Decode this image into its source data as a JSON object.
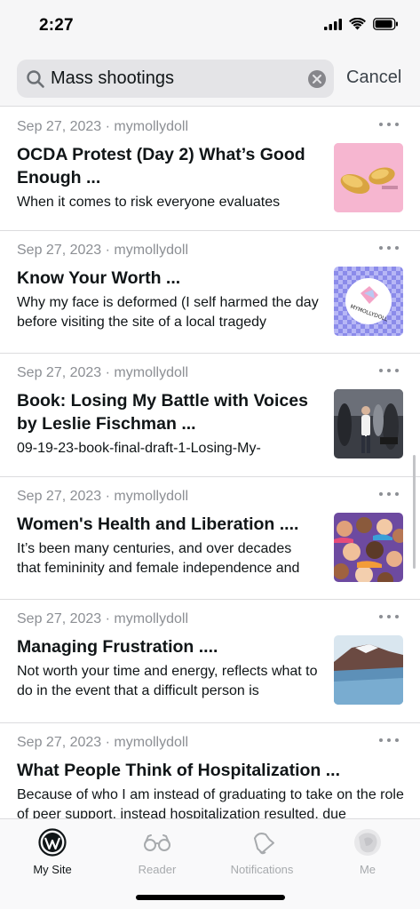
{
  "status_bar": {
    "time": "2:27"
  },
  "search": {
    "query": "Mass shootings",
    "cancel_label": "Cancel"
  },
  "posts": [
    {
      "date": "Sep 27, 2023",
      "author": "mymollydoll",
      "title": "OCDA Protest (Day 2) What’s Good Enough ...",
      "excerpt": "When it comes to risk everyone evaluates",
      "thumb": "boxing-gloves"
    },
    {
      "date": "Sep 27, 2023",
      "author": "mymollydoll",
      "title": "Know Your Worth ...",
      "excerpt": "Why my face is deformed (I self harmed the day before visiting the site of a local tragedy",
      "thumb": "mymollydoll-logo",
      "thumb_text": "MYMOLLYDOLL"
    },
    {
      "date": "Sep 27, 2023",
      "author": "mymollydoll",
      "title": "Book: Losing My Battle with Voices by Leslie Fischman ...",
      "excerpt": "09-19-23-book-final-draft-1-Losing-My-",
      "thumb": "crowd-photo"
    },
    {
      "date": "Sep 27, 2023",
      "author": "mymollydoll",
      "title": "Women's Health and Liberation ....",
      "excerpt": "It’s been many centuries, and over decades that femininity and female independence and",
      "thumb": "women-illustration"
    },
    {
      "date": "Sep 27, 2023",
      "author": "mymollydoll",
      "title": "Managing Frustration ....",
      "excerpt": "Not worth your time and energy, reflects what to do in the event that a difficult person is",
      "thumb": "mountain-lake"
    },
    {
      "date": "Sep 27, 2023",
      "author": "mymollydoll",
      "title": "What People Think of Hospitalization ...",
      "excerpt": "Because of who I am instead of graduating to take on the role of peer support, instead hospitalization resulted, due",
      "thumb": ""
    }
  ],
  "tabs": [
    {
      "label": "My Site",
      "icon": "wordpress-icon",
      "active": true
    },
    {
      "label": "Reader",
      "icon": "glasses-icon",
      "active": false
    },
    {
      "label": "Notifications",
      "icon": "bell-icon",
      "active": false
    },
    {
      "label": "Me",
      "icon": "avatar-icon",
      "active": false
    }
  ],
  "colors": {
    "text": "#101517",
    "meta": "#8c8f94",
    "inactive_tab": "#a7aaad",
    "search_bg": "#e4e4e7"
  }
}
